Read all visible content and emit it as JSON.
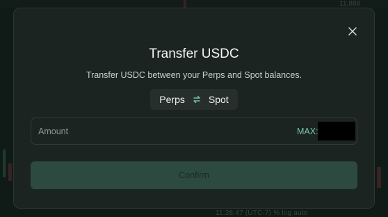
{
  "background": {
    "top_text": "11,888",
    "bottom_text": "11:28:47 (UTC-7)    %    log    auto"
  },
  "modal": {
    "title": "Transfer USDC",
    "subtitle": "Transfer USDC between your Perps and Spot balances.",
    "switch": {
      "from": "Perps",
      "to": "Spot",
      "icon": "swap-arrows-icon"
    },
    "amount": {
      "placeholder": "Amount",
      "max_label": "MAX:",
      "max_value": ""
    },
    "confirm_label": "Confirm",
    "close_icon": "close-icon"
  },
  "colors": {
    "accent": "#73c3ac",
    "button_bg": "#2c4a40",
    "modal_bg": "#1b2420"
  }
}
